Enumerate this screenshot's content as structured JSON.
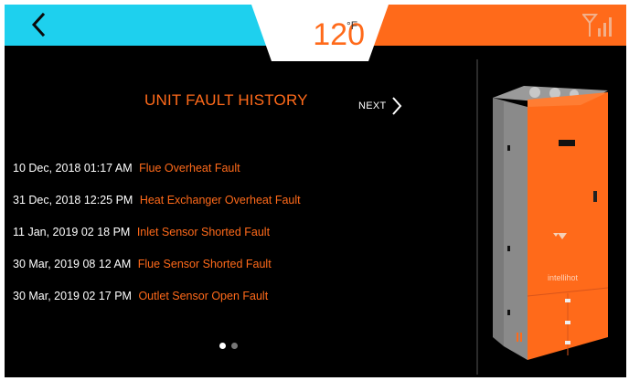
{
  "header": {
    "temperature": "120",
    "temperature_unit": "°F",
    "back_icon": "chevron-left-icon",
    "signal_icon": "signal-strength-icon"
  },
  "history": {
    "title": "UNIT FAULT HISTORY",
    "next_label": "NEXT",
    "faults": [
      {
        "date": "10 Dec, 2018 01:17 AM",
        "description": "Flue Overheat Fault"
      },
      {
        "date": "31 Dec, 2018 12:25 PM",
        "description": "Heat Exchanger Overheat Fault"
      },
      {
        "date": "11 Jan, 2019 02 18 PM",
        "description": "Inlet Sensor Shorted Fault"
      },
      {
        "date": "30 Mar, 2019 08 12 AM",
        "description": "Flue Sensor Shorted Fault"
      },
      {
        "date": "30 Mar, 2019 02 17 PM",
        "description": "Outlet Sensor Open Fault"
      }
    ],
    "page_current": 1,
    "page_total": 2
  },
  "product": {
    "brand_label": "intellihot"
  },
  "colors": {
    "accent_orange": "#ff6a1a",
    "accent_cyan": "#1ed0ee",
    "background": "#000000"
  }
}
